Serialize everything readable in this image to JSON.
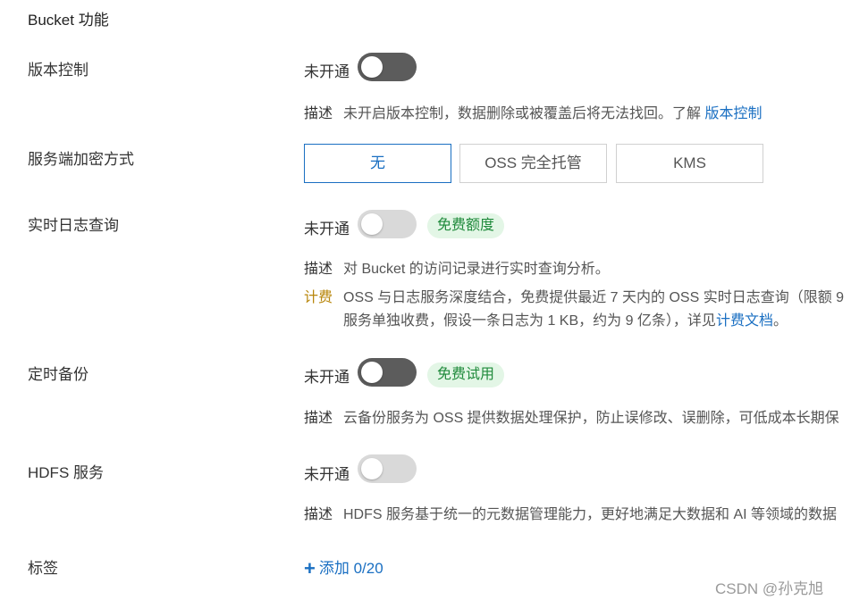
{
  "section": {
    "title": "Bucket 功能"
  },
  "versioning": {
    "label": "版本控制",
    "status": "未开通",
    "desc_key": "描述",
    "desc_text": "未开启版本控制，数据删除或被覆盖后将无法找回。了解",
    "desc_link": "版本控制"
  },
  "encryption": {
    "label": "服务端加密方式",
    "options": [
      "无",
      "OSS 完全托管",
      "KMS"
    ],
    "selected": "无"
  },
  "realtime_log": {
    "label": "实时日志查询",
    "status": "未开通",
    "badge": "免费额度",
    "desc_key": "描述",
    "desc_text": "对 Bucket 的访问记录进行实时查询分析。",
    "fee_key": "计费",
    "fee_line1": "OSS 与日志服务深度结合，免费提供最近 7 天内的 OSS 实时日志查询（限额 9",
    "fee_line2": "服务单独收费，假设一条日志为 1 KB，约为 9 亿条），详见",
    "fee_link": "计费文档",
    "fee_end": "。"
  },
  "backup": {
    "label": "定时备份",
    "status": "未开通",
    "badge": "免费试用",
    "desc_key": "描述",
    "desc_text": "云备份服务为 OSS 提供数据处理保护，防止误修改、误删除，可低成本长期保"
  },
  "hdfs": {
    "label": "HDFS 服务",
    "status": "未开通",
    "desc_key": "描述",
    "desc_text": "HDFS 服务基于统一的元数据管理能力，更好地满足大数据和 AI 等领域的数据"
  },
  "tags": {
    "label": "标签",
    "add_icon": "plus-icon",
    "add_label": "添加 0/20"
  },
  "watermark": "CSDN @孙克旭",
  "colors": {
    "accent": "#1a6fc2",
    "badge_bg": "#e3f6e6",
    "badge_text": "#1f8a3b",
    "fee": "#b8860b"
  }
}
